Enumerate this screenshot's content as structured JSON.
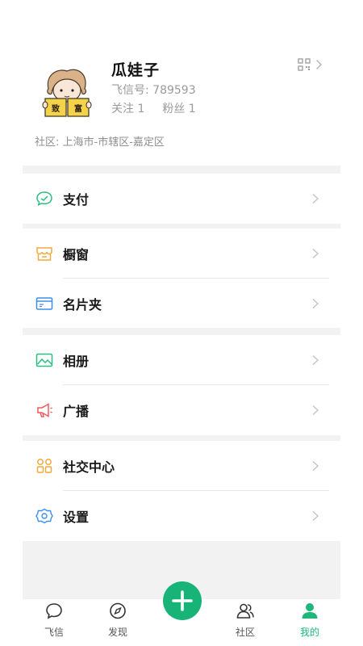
{
  "profile": {
    "name": "瓜娃子",
    "id_line": "飞信号: 789593",
    "following": "关注 1",
    "fans": "粉丝 1",
    "avatar_text_left": "致",
    "avatar_text_right": "富",
    "community": "社区: 上海市-市辖区-嘉定区"
  },
  "menu": {
    "pay": "支付",
    "shop": "橱窗",
    "cards": "名片夹",
    "album": "相册",
    "broadcast": "广播",
    "social": "社交中心",
    "settings": "设置"
  },
  "tabs": {
    "feixin": "飞信",
    "discover": "发现",
    "community": "社区",
    "mine": "我的"
  },
  "colors": {
    "accent": "#18b477",
    "pay_icon": "#2bbf7f",
    "shop_icon": "#f3a93c",
    "cards_icon": "#3b8ff0",
    "album_icon": "#2bbf7f",
    "broadcast_icon": "#f05a5a",
    "social_icon": "#f3a93c",
    "settings_icon": "#3b8ff0"
  }
}
